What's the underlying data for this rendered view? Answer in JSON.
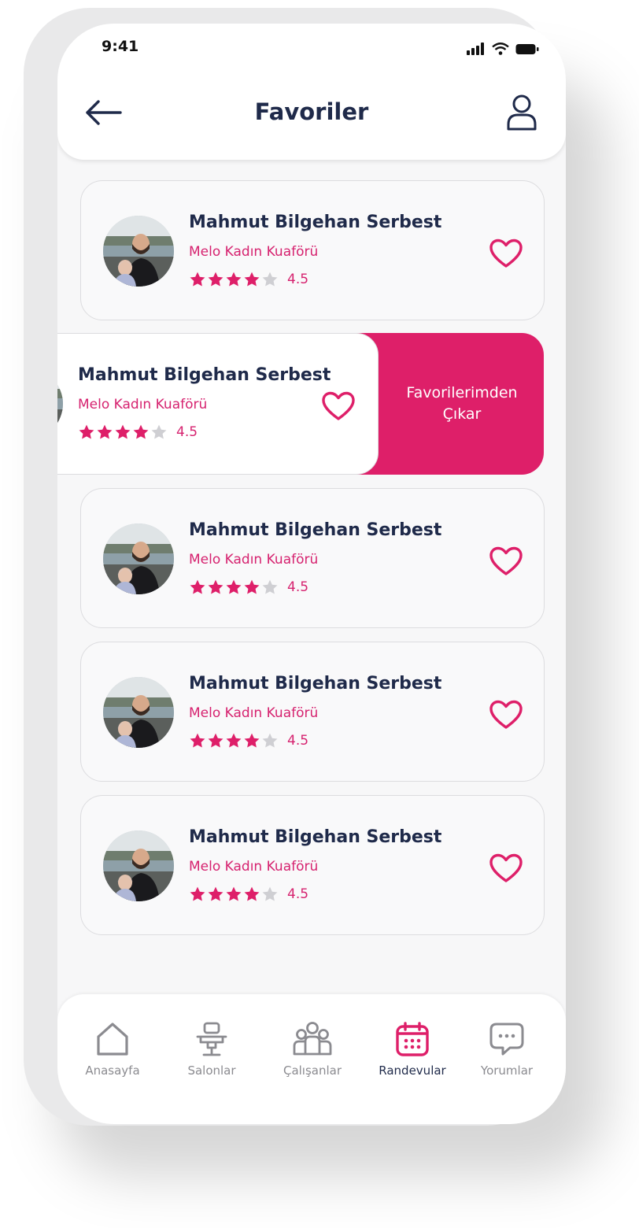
{
  "status_bar": {
    "time": "9:41"
  },
  "header": {
    "title": "Favoriler"
  },
  "colors": {
    "accent": "#de1f69",
    "text_dark": "#1f2a4a",
    "inactive": "#8b8b90"
  },
  "cards": [
    {
      "name": "Mahmut Bilgehan Serbest",
      "salon": "Melo Kadın Kuaförü",
      "rating": "4.5",
      "stars_filled": 4
    },
    {
      "name": "Mahmut Bilgehan Serbest",
      "salon": "Melo Kadın Kuaförü",
      "rating": "4.5",
      "stars_filled": 4
    },
    {
      "name": "Mahmut Bilgehan Serbest",
      "salon": "Melo Kadın Kuaförü",
      "rating": "4.5",
      "stars_filled": 4
    },
    {
      "name": "Mahmut Bilgehan Serbest",
      "salon": "Melo Kadın Kuaförü",
      "rating": "4.5",
      "stars_filled": 4
    },
    {
      "name": "Mahmut Bilgehan Serbest",
      "salon": "Melo Kadın Kuaförü",
      "rating": "4.5",
      "stars_filled": 4
    }
  ],
  "swipe_action": {
    "label_line1": "Favorilerimden",
    "label_line2": "Çıkar"
  },
  "bottom_nav": [
    {
      "label": "Anasayfa",
      "icon": "home-icon"
    },
    {
      "label": "Salonlar",
      "icon": "salon-chair-icon"
    },
    {
      "label": "Çalışanlar",
      "icon": "people-icon"
    },
    {
      "label": "Randevular",
      "icon": "calendar-icon",
      "active": true
    },
    {
      "label": "Yorumlar",
      "icon": "chat-icon"
    }
  ]
}
